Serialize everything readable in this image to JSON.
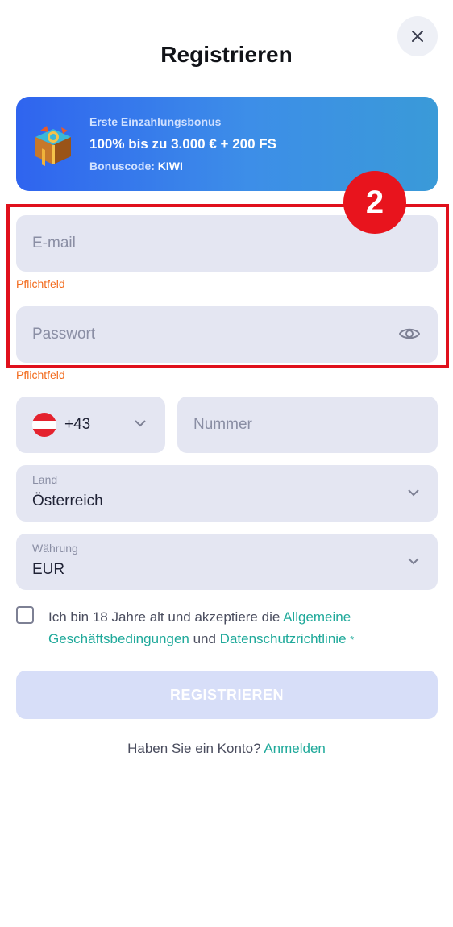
{
  "header": {
    "title": "Registrieren",
    "close_icon": "close-icon"
  },
  "bonus": {
    "line1": "Erste Einzahlungsbonus",
    "line2": "100% bis zu 3.000 € + 200 FS",
    "code_label": "Bonuscode:",
    "code_value": "KIWI",
    "icon": "treasure-chest-icon"
  },
  "form": {
    "email": {
      "placeholder": "E-mail",
      "value": "",
      "error": "Pflichtfeld"
    },
    "password": {
      "placeholder": "Passwort",
      "value": "",
      "error": "Pflichtfeld",
      "icon": "eye-icon"
    },
    "phone": {
      "flag": "austria-flag-icon",
      "code": "+43",
      "placeholder": "Nummer",
      "value": ""
    },
    "country": {
      "label": "Land",
      "value": "Österreich"
    },
    "currency": {
      "label": "Währung",
      "value": "EUR"
    },
    "terms": {
      "checked": false,
      "text_before": "Ich bin 18 Jahre alt und akzeptiere die ",
      "link1": "Allgemeine Geschäftsbedingungen",
      "text_middle": " und ",
      "link2": "Datenschutzrichtlinie",
      "required_mark": "*"
    },
    "submit_label": "REGISTRIEREN"
  },
  "footer": {
    "question": "Haben Sie ein Konto? ",
    "login_link": "Anmelden"
  },
  "annotation": {
    "badge_number": "2"
  },
  "colors": {
    "accent_link": "#1fa99a",
    "error": "#f26b1d",
    "field_bg": "#e4e6f2",
    "highlight_red": "#e0101c",
    "bonus_gradient_start": "#2f64ef",
    "bonus_gradient_end": "#3a9ad8",
    "button_disabled": "#d7def8"
  }
}
